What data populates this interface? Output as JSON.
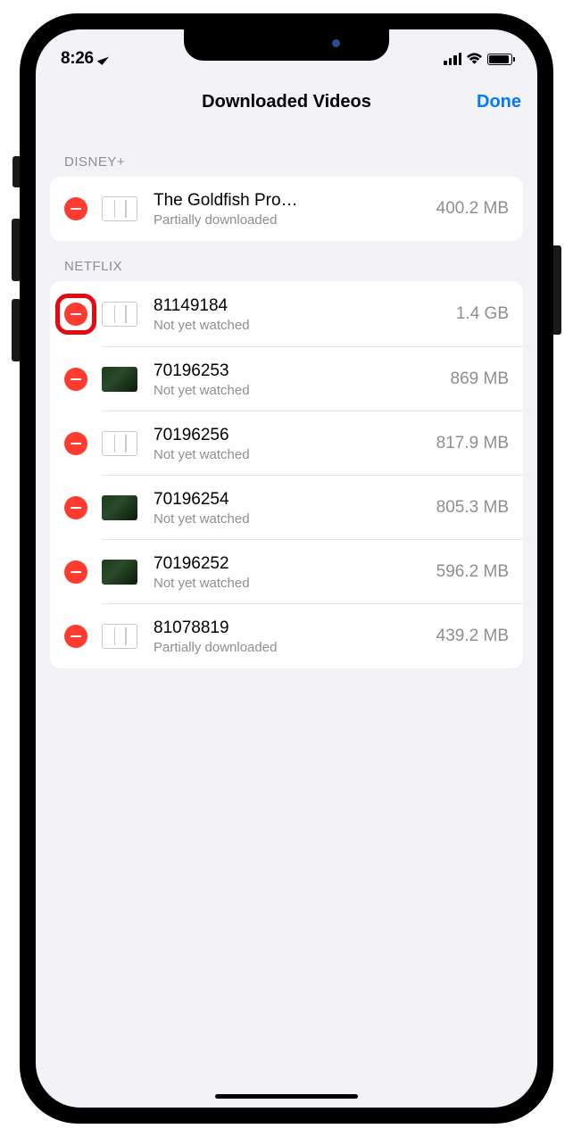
{
  "statusBar": {
    "time": "8:26"
  },
  "nav": {
    "title": "Downloaded Videos",
    "done": "Done"
  },
  "sections": [
    {
      "header": "DISNEY+",
      "items": [
        {
          "title": "The Goldfish Pro…",
          "subtitle": "Partially downloaded",
          "size": "400.2 MB",
          "thumbType": "placeholder",
          "highlighted": false
        }
      ]
    },
    {
      "header": "NETFLIX",
      "items": [
        {
          "title": "81149184",
          "subtitle": "Not yet watched",
          "size": "1.4 GB",
          "thumbType": "placeholder",
          "highlighted": true
        },
        {
          "title": "70196253",
          "subtitle": "Not yet watched",
          "size": "869 MB",
          "thumbType": "img",
          "highlighted": false
        },
        {
          "title": "70196256",
          "subtitle": "Not yet watched",
          "size": "817.9 MB",
          "thumbType": "placeholder",
          "highlighted": false
        },
        {
          "title": "70196254",
          "subtitle": "Not yet watched",
          "size": "805.3 MB",
          "thumbType": "img",
          "highlighted": false
        },
        {
          "title": "70196252",
          "subtitle": "Not yet watched",
          "size": "596.2 MB",
          "thumbType": "img",
          "highlighted": false
        },
        {
          "title": "81078819",
          "subtitle": "Partially downloaded",
          "size": "439.2 MB",
          "thumbType": "placeholder",
          "highlighted": false
        }
      ]
    }
  ]
}
